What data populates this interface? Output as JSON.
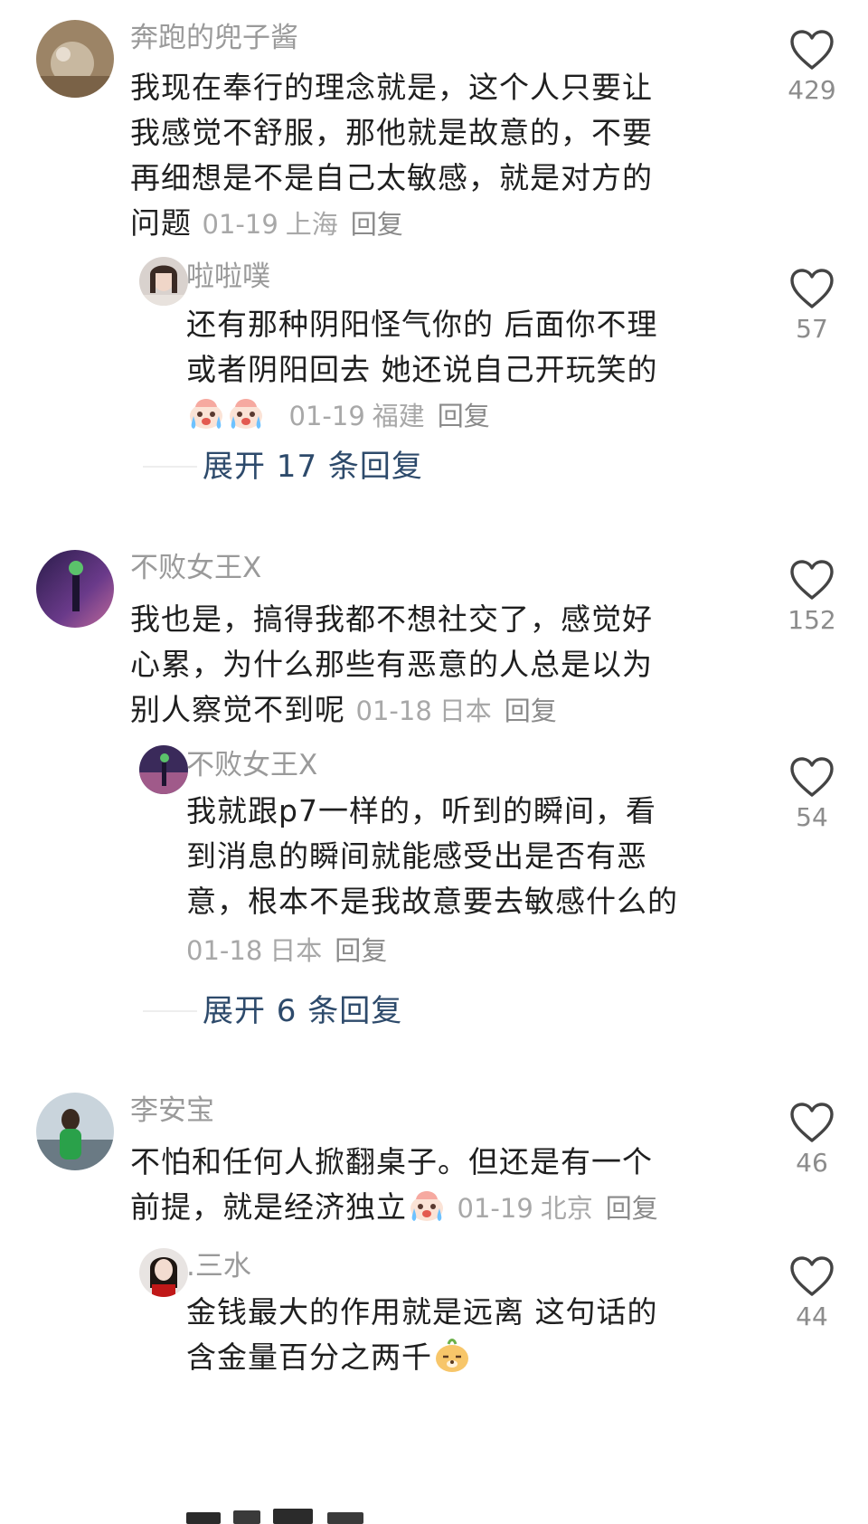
{
  "colors": {
    "expand_text": "#2d4a6b",
    "name_text": "#9a9a9a",
    "meta_text": "#a8a8a8"
  },
  "comments": [
    {
      "username": "奔跑的兜子酱",
      "lines": [
        "我现在奉行的理念就是，这个人只要让",
        "我感觉不舒服，那他就是故意的，不要",
        "再细想是不是自己太敏感，就是对方的",
        "问题"
      ],
      "date": "01-19",
      "location": "上海",
      "reply_label": "回复",
      "likes": "429",
      "reply": {
        "username": "啦啦噗",
        "lines": [
          "还有那种阴阳怪气你的  后面你不理",
          "或者阴阳回去  她还说自己开玩笑的"
        ],
        "date": "01-19",
        "location": "福建",
        "reply_label": "回复",
        "likes": "57",
        "emoji": [
          "crying-face-icon",
          "crying-face-icon"
        ]
      },
      "expand_label": "展开 17 条回复"
    },
    {
      "username": "不败女王X",
      "lines": [
        "我也是，搞得我都不想社交了，感觉好",
        "心累，为什么那些有恶意的人总是以为",
        "别人察觉不到呢"
      ],
      "date": "01-18",
      "location": "日本",
      "reply_label": "回复",
      "likes": "152",
      "reply": {
        "username": "不败女王X",
        "lines": [
          "我就跟p7一样的，听到的瞬间，看",
          "到消息的瞬间就能感受出是否有恶",
          "意，根本不是我故意要去敏感什么的"
        ],
        "date": "01-18",
        "location": "日本",
        "reply_label": "回复",
        "likes": "54"
      },
      "expand_label": "展开 6 条回复"
    },
    {
      "username": "李安宝",
      "lines": [
        "不怕和任何人掀翻桌子。但还是有一个",
        "前提，就是经济独立"
      ],
      "date": "01-19",
      "location": "北京",
      "reply_label": "回复",
      "likes": "46",
      "emoji": "crying-face-icon",
      "reply": {
        "username": ".三水",
        "lines": [
          "金钱最大的作用就是远离  这句话的",
          "含金量百分之两千"
        ],
        "likes": "44",
        "emoji": "smug-dog-icon"
      }
    }
  ]
}
